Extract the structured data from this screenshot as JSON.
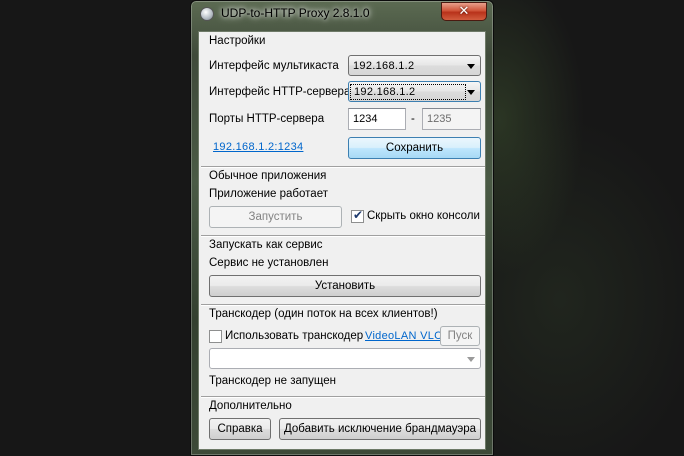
{
  "window": {
    "title": "UDP-to-HTTP Proxy 2.8.1.0",
    "close_glyph": "✕"
  },
  "settings": {
    "group_title": "Настройки",
    "multicast_iface_label": "Интерфейс мультикаста",
    "multicast_iface_value": "192.168.1.2",
    "http_iface_label": "Интерфейс HTTP-сервера",
    "http_iface_value": "192.168.1.2",
    "ports_label": "Порты HTTP-сервера",
    "port_from": "1234",
    "port_dash": "-",
    "port_to": "1235",
    "server_link": "192.168.1.2:1234",
    "save_label": "Сохранить"
  },
  "app": {
    "group_title": "Обычное приложения",
    "status": "Приложение работает",
    "start_label": "Запустить",
    "hide_console_label": "Скрыть окно консоли",
    "hide_console_checked": true
  },
  "service": {
    "group_title": "Запускать как сервис",
    "status": "Сервис не установлен",
    "install_label": "Установить"
  },
  "transcoder": {
    "group_title": "Транскодер (один поток на всех клиентов!)",
    "use_label": "Использовать транскодер",
    "use_checked": false,
    "vlc_link": "VideoLAN VLC",
    "start_label": "Пуск",
    "path_value": "",
    "status": "Транскодер не запущен"
  },
  "extra": {
    "group_title": "Дополнительно",
    "help_label": "Справка",
    "firewall_label": "Добавить исключение брандмауэра"
  },
  "colors": {
    "link": "#0066cc",
    "close_button": "#c8452a",
    "default_button": "#bee6fd"
  }
}
